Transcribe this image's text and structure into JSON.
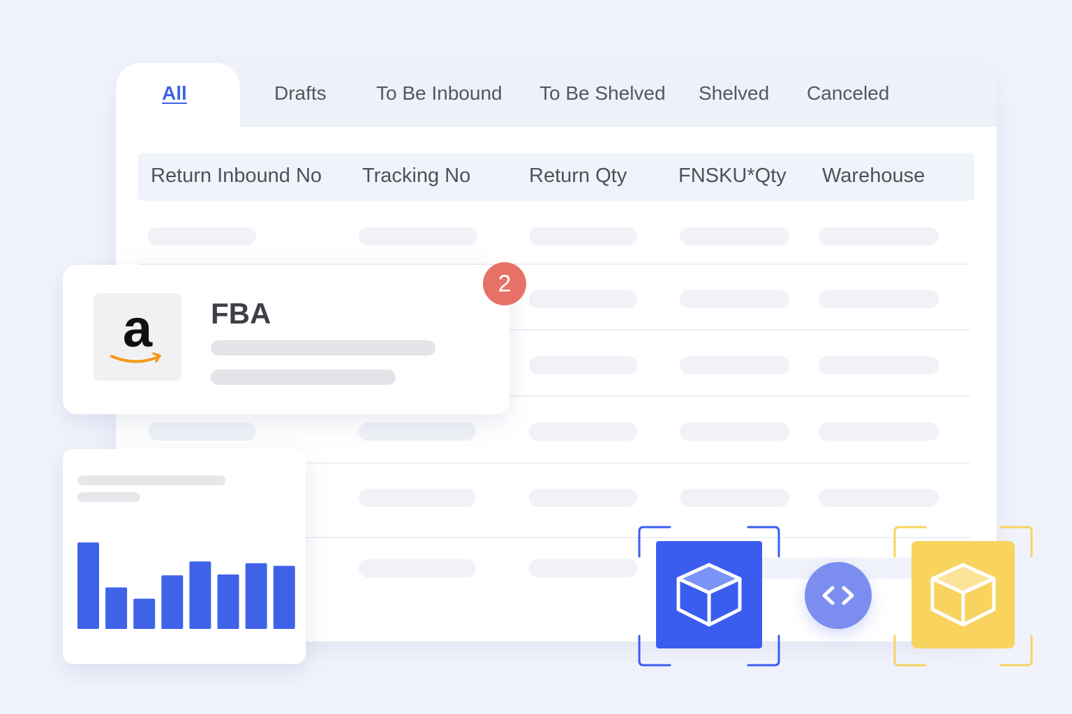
{
  "tabs": [
    {
      "label": "All",
      "active": true
    },
    {
      "label": "Drafts",
      "active": false
    },
    {
      "label": "To Be Inbound",
      "active": false
    },
    {
      "label": "To Be Shelved",
      "active": false
    },
    {
      "label": "Shelved",
      "active": false
    },
    {
      "label": "Canceled",
      "active": false
    }
  ],
  "table": {
    "columns": [
      "Return Inbound No",
      "Tracking No",
      "Return Qty",
      "FNSKU*Qty",
      "Warehouse"
    ]
  },
  "fba_card": {
    "logo_letter": "a",
    "title": "FBA",
    "badge_count": "2"
  },
  "mini_chart": {
    "type": "bar",
    "values": [
      100,
      48,
      35,
      62,
      78,
      63,
      76,
      73
    ]
  },
  "colors": {
    "accent": "#3f63e8",
    "badge": "#e77167",
    "blue_box": "#3a5df0",
    "yellow_box": "#f8d35e",
    "amazon_smile": "#f39a1c"
  },
  "icons": {
    "blue_box": "cube-icon",
    "yellow_box": "cube-icon",
    "sync": "code-arrows-icon"
  }
}
